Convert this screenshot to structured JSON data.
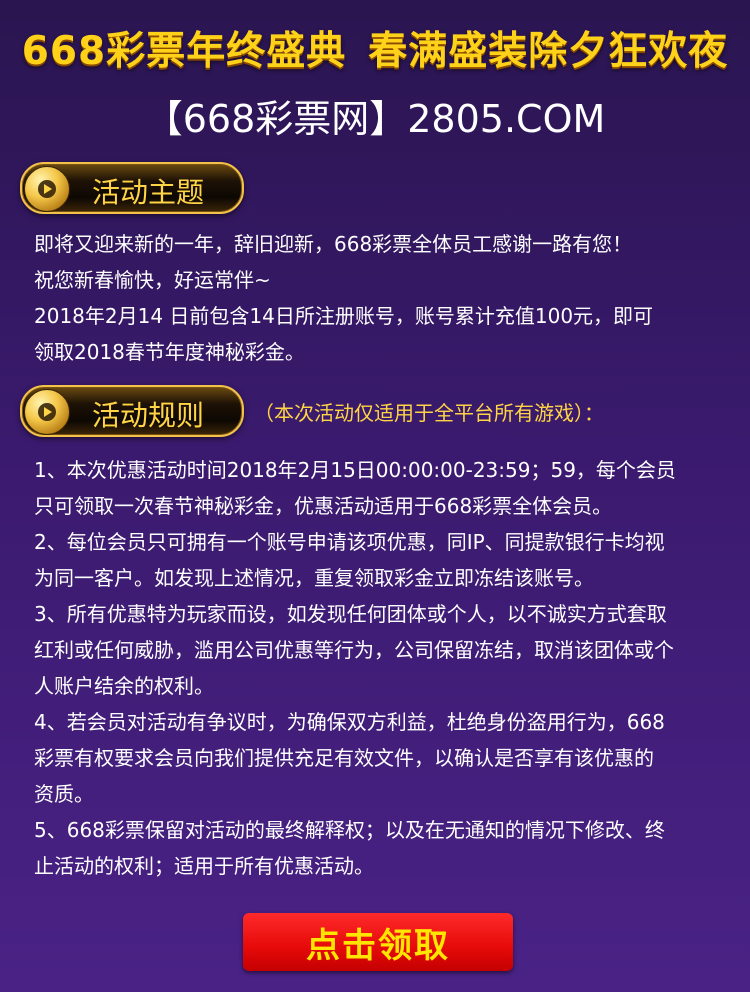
{
  "banner": {
    "title_part1": "668彩票年终盛典",
    "title_part2": "春满盛装除夕狂欢夜",
    "site_name": "【668彩票网】2805.COM"
  },
  "theme_section": {
    "header_label": "活动主题",
    "lines": [
      "即将又迎来新的一年，辞旧迎新，668彩票全体员工感谢一路有您！",
      "祝您新春愉快，好运常伴~",
      "2018年2月14 日前包含14日所注册账号，账号累计充值100元，即可",
      "领取2018春节年度神秘彩金。"
    ]
  },
  "rules_section": {
    "header_label": "活动规则",
    "note": "（本次活动仅适用于全平台所有游戏）：",
    "lines": [
      "1、本次优惠活动时间2018年2月15日00:00:00-23:59；59，每个会员",
      "只可领取一次春节神秘彩金，优惠活动适用于668彩票全体会员。",
      "2、每位会员只可拥有一个账号申请该项优惠，同IP、同提款银行卡均视",
      "为同一客户。如发现上述情况，重复领取彩金立即冻结该账号。",
      "3、所有优惠特为玩家而设，如发现任何团体或个人，以不诚实方式套取",
      "红利或任何威胁，滥用公司优惠等行为，公司保留冻结，取消该团体或个",
      "人账户结余的权利。",
      "4、若会员对活动有争议时，为确保双方利益，杜绝身份盗用行为，668",
      "彩票有权要求会员向我们提供充足有效文件，以确认是否享有该优惠的",
      "资质。",
      "5、668彩票保留对活动的最终解释权；以及在无通知的情况下修改、终",
      "止活动的权利；适用于所有优惠活动。"
    ]
  },
  "claim_button": {
    "label": "点击领取"
  },
  "icons": {
    "section_marker": "play-icon"
  },
  "colors": {
    "background": "#3a1a6e",
    "title_gold": "#ffd21a",
    "accent_gold": "#ffd445",
    "button_red": "#e60a0a",
    "button_text": "#ffe600"
  }
}
